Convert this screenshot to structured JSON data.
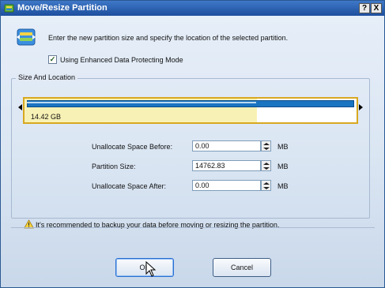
{
  "window": {
    "title": "Move/Resize Partition",
    "help_button": "?",
    "close_button": "X"
  },
  "intro_text": "Enter the new partition size and specify the location of the selected partition.",
  "enhanced_mode": {
    "label": "Using Enhanced Data Protecting Mode",
    "checked": true
  },
  "group_title": "Size And Location",
  "partition_map": {
    "label": "14.42 GB",
    "used_fraction": 0.7
  },
  "fields": [
    {
      "label": "Unallocate Space Before:",
      "value": "0.00",
      "unit": "MB"
    },
    {
      "label": "Partition Size:",
      "value": "14762.83",
      "unit": "MB"
    },
    {
      "label": "Unallocate Space After:",
      "value": "0.00",
      "unit": "MB"
    }
  ],
  "warning_text": "It's recommended to backup your data before moving or resizing the partition.",
  "buttons": {
    "ok": "OK",
    "cancel": "Cancel"
  },
  "colors": {
    "title_bar": "#1d4f9e",
    "partition_bar": "#1b74c0",
    "used_space": "#f8f1b5",
    "map_border": "#d8a820"
  }
}
